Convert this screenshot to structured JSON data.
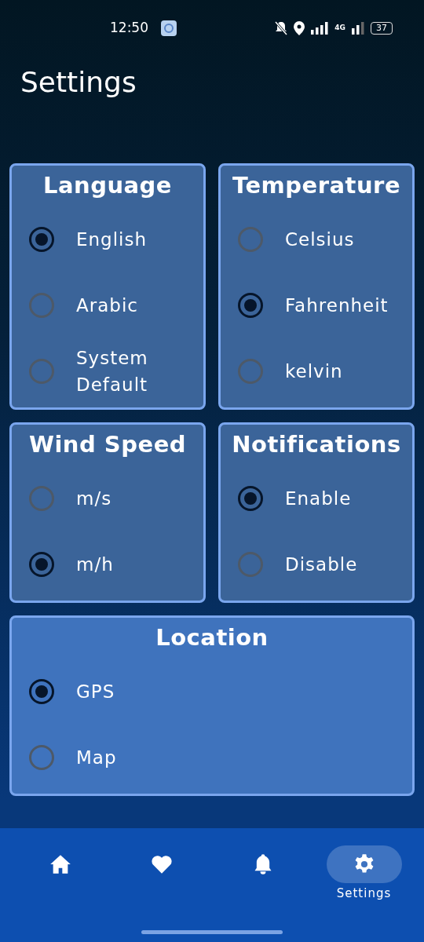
{
  "status_bar": {
    "time": "12:50",
    "network": "4G",
    "battery": "37"
  },
  "title": "Settings",
  "groups": [
    {
      "title": "Language",
      "kind": "half",
      "options": [
        {
          "label": "English",
          "selected": true
        },
        {
          "label": "Arabic",
          "selected": false
        },
        {
          "label": "System Default",
          "selected": false
        }
      ]
    },
    {
      "title": "Temperature",
      "kind": "half",
      "options": [
        {
          "label": "Celsius",
          "selected": false
        },
        {
          "label": "Fahrenheit",
          "selected": true
        },
        {
          "label": "kelvin",
          "selected": false
        }
      ]
    },
    {
      "title": "Wind Speed",
      "kind": "half",
      "options": [
        {
          "label": "m/s",
          "selected": false
        },
        {
          "label": "m/h",
          "selected": true
        }
      ]
    },
    {
      "title": "Notifications",
      "kind": "half",
      "options": [
        {
          "label": "Enable",
          "selected": true
        },
        {
          "label": "Disable",
          "selected": false
        }
      ]
    },
    {
      "title": "Location",
      "kind": "full",
      "options": [
        {
          "label": "GPS",
          "selected": true
        },
        {
          "label": "Map",
          "selected": false
        }
      ]
    }
  ],
  "nav": [
    {
      "kind": "home",
      "selected": false
    },
    {
      "kind": "heart",
      "selected": false
    },
    {
      "kind": "bell",
      "selected": false
    },
    {
      "kind": "gear",
      "label": "Settings",
      "selected": true
    }
  ]
}
